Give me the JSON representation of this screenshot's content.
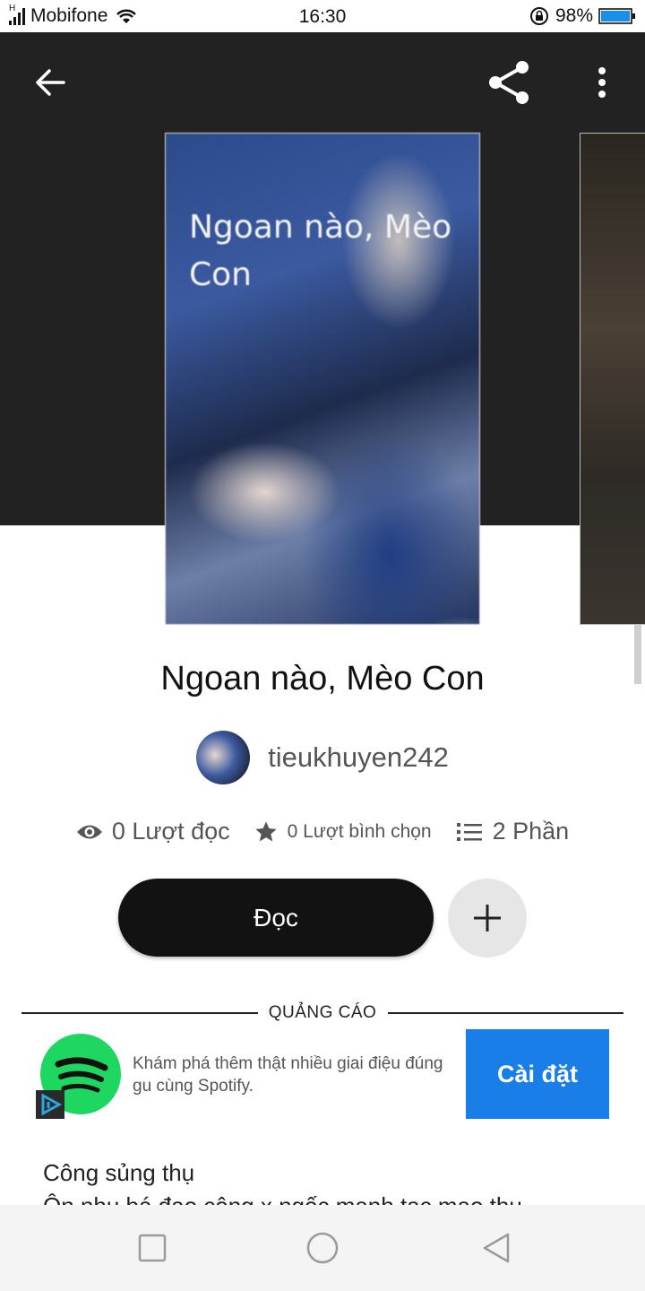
{
  "status_bar": {
    "network_type": "H",
    "carrier": "Mobifone",
    "time": "16:30",
    "battery_percent": "98%"
  },
  "header": {
    "back_icon": "arrow-left-icon",
    "share_icon": "share-icon",
    "more_icon": "more-vertical-icon"
  },
  "story": {
    "cover_text": "Ngoan nào, Mèo Con",
    "title": "Ngoan nào, Mèo Con",
    "author": "tieukhuyen242",
    "stats": {
      "reads": "0 Lượt đọc",
      "votes": "0 Lượt bình chọn",
      "parts": "2 Phần"
    },
    "read_button": "Đọc"
  },
  "ad": {
    "label": "QUẢNG CÁO",
    "text": "Khám phá thêm thật nhiều giai điệu đúng gu cùng Spotify.",
    "install_button": "Cài đặt",
    "brand_color": "#1ed760",
    "button_color": "#1a7ee8"
  },
  "description": {
    "line1": "Công sủng thụ",
    "line2": "Ôn nhu bá đạo công x ngốc manh tạc mao thụ"
  },
  "nav_bar": {
    "recent_icon": "square-icon",
    "home_icon": "circle-icon",
    "back_icon": "triangle-back-icon"
  }
}
